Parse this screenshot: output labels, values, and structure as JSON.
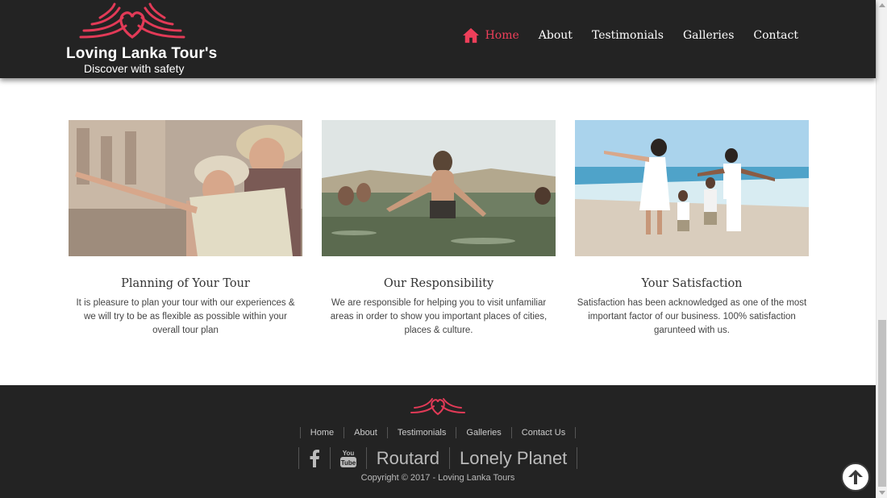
{
  "brand": {
    "name": "Loving Lanka Tour's",
    "tagline": "Discover with safety",
    "accent_color": "#ee3f5a"
  },
  "nav": {
    "items": [
      {
        "label": "Home",
        "icon": "home-icon",
        "active": true
      },
      {
        "label": "About"
      },
      {
        "label": "Testimonials"
      },
      {
        "label": "Galleries"
      },
      {
        "label": "Contact"
      }
    ]
  },
  "features": [
    {
      "title": "Planning of Your Tour",
      "text": "It is pleasure to plan your tour with our experiences & we will try to be as flexible as possible within your overall tour plan",
      "image": "couple-with-map-photo"
    },
    {
      "title": "Our Responsibility",
      "text": "We are responsible for helping you to visit unfamiliar areas in order to show you important places of cities, places & culture.",
      "image": "woman-in-water-photo"
    },
    {
      "title": "Your Satisfaction",
      "text": "Satisfaction has been acknowledged as one of the most important factor of our business. 100% satisfaction garunteed with us.",
      "image": "family-on-beach-photo"
    }
  ],
  "footer": {
    "links": [
      "Home",
      "About",
      "Testimonials",
      "Galleries",
      "Contact Us"
    ],
    "social": [
      {
        "icon": "facebook-icon"
      },
      {
        "icon": "youtube-icon"
      },
      {
        "label": "Routard"
      },
      {
        "label": "Lonely Planet"
      }
    ],
    "copyright": "Copyright © 2017 - Loving Lanka Tours"
  },
  "scroll_top": {
    "icon": "arrow-up-circle-icon"
  }
}
